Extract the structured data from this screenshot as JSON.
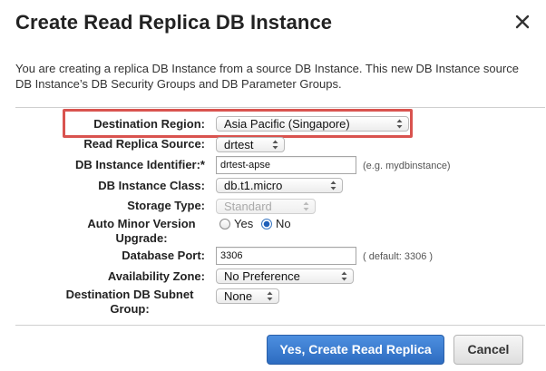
{
  "dialog": {
    "title": "Create Read Replica DB Instance",
    "description": "You are creating a replica DB Instance from a source DB Instance. This new DB Instance source DB Instance’s DB Security Groups and DB Parameter Groups."
  },
  "form": {
    "destination_region": {
      "label": "Destination Region:",
      "value": "Asia Pacific (Singapore)"
    },
    "read_replica_source": {
      "label": "Read Replica Source:",
      "value": "drtest"
    },
    "db_instance_identifier": {
      "label": "DB Instance Identifier:*",
      "value": "drtest-apse",
      "hint": "(e.g. mydbinstance)"
    },
    "db_instance_class": {
      "label": "DB Instance Class:",
      "value": "db.t1.micro"
    },
    "storage_type": {
      "label": "Storage Type:",
      "value": "Standard"
    },
    "auto_minor_version_upgrade": {
      "label_line1": "Auto Minor Version",
      "label_line2": "Upgrade:",
      "options": [
        "Yes",
        "No"
      ],
      "selected": "No"
    },
    "database_port": {
      "label": "Database Port:",
      "value": "3306",
      "hint": "( default: 3306 )"
    },
    "availability_zone": {
      "label": "Availability Zone:",
      "value": "No Preference"
    },
    "destination_db_subnet_group": {
      "label_line1": "Destination DB Subnet",
      "label_line2": "Group:",
      "value": "None"
    }
  },
  "buttons": {
    "primary": "Yes, Create Read Replica",
    "cancel": "Cancel"
  },
  "colors": {
    "highlight": "#d9534f",
    "primary_button": "#3a7bd5"
  },
  "icons": {
    "close": "close-icon",
    "select_arrow": "updown-arrows-icon"
  }
}
